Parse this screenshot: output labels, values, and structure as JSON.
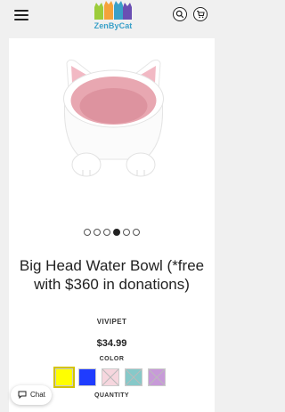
{
  "header": {
    "menu_icon": "hamburger-menu-icon",
    "logo_text": "ZenByCat",
    "search_icon": "search-icon",
    "cart_icon": "cart-icon"
  },
  "product": {
    "title": "Big Head Water Bowl (*free with $360 in donations)",
    "vendor": "VIVIPET",
    "price": "$34.99",
    "color_label": "COLOR",
    "quantity_label": "QUANTITY",
    "gallery": {
      "slide_count": 6,
      "active_slide": 4
    },
    "colors": [
      {
        "hex": "#ffff00",
        "selected": true,
        "available": true
      },
      {
        "hex": "#1f3cff",
        "selected": false,
        "available": true
      },
      {
        "hex": "#f6d6de",
        "selected": false,
        "available": false
      },
      {
        "hex": "#86c9c9",
        "selected": false,
        "available": false
      },
      {
        "hex": "#c79ad8",
        "selected": false,
        "available": false
      }
    ]
  },
  "chat": {
    "label": "Chat",
    "icon": "chat-bubble-icon"
  },
  "theme": {
    "background": "#f0f0f0",
    "card": "#ffffff",
    "logo_text_color": "#3aa0c8"
  }
}
